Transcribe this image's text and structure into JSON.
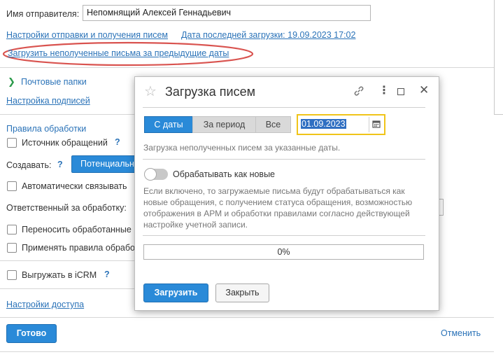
{
  "form": {
    "sender_label": "Имя отправителя:",
    "sender_value": "Непомнящий Алексей Геннадьевич",
    "send_receive_settings": "Настройки отправки и получения писем",
    "last_load": "Дата последней загрузки: 19.09.2023 17:02",
    "load_unreceived": "Загрузить неполученные письма за предыдущие даты",
    "mail_folders": "Почтовые папки",
    "signature_settings": "Настройка подписей",
    "processing_rules": "Правила обработки",
    "request_source": "Источник обращений",
    "create_label": "Создавать:",
    "create_value": "Потенциальн",
    "auto_link": "Автоматически связывать",
    "responsible_label": "Ответственный за обработку:",
    "move_processed": "Переносить обработанные",
    "apply_rules": "Применять правила обработ",
    "export_icrm": "Выгружать в iCRM",
    "access_settings": "Настройки доступа",
    "done_button": "Готово",
    "cancel_link": "Отменить",
    "help_mark": "?"
  },
  "dialog": {
    "title": "Загрузка писем",
    "tabs": [
      "С даты",
      "За период",
      "Все"
    ],
    "date_value": "01.09.2023",
    "date_hint": "Загрузка неполученных писем за указанные даты.",
    "toggle_label": "Обрабатывать как новые",
    "description": "Если включено, то загружаемые письма будут обрабатываться как новые обращения, с получением статуса обращения, возможностью отображения в АРМ и обработки правилами согласно действующей настройке учетной записи.",
    "progress_text": "0%",
    "progress_value": 0,
    "load_button": "Загрузить",
    "close_button": "Закрыть"
  },
  "colors": {
    "accent": "#2a8ad8",
    "link": "#2b73b8",
    "highlight_oval": "#d9534f",
    "date_focus": "#f0c419"
  }
}
